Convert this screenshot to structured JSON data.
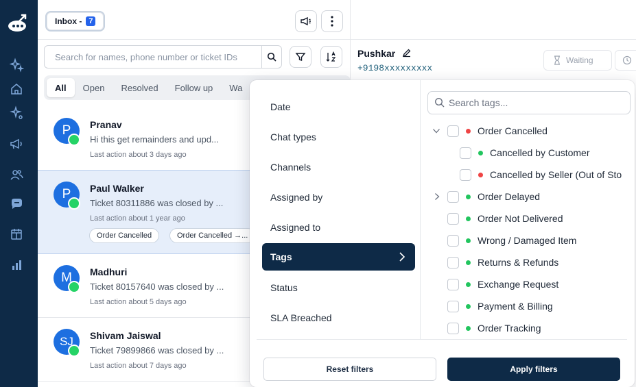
{
  "inbox": {
    "label": "Inbox -",
    "count": "7"
  },
  "search": {
    "placeholder": "Search for names, phone number or ticket IDs"
  },
  "tabs": [
    "All",
    "Open",
    "Resolved",
    "Follow up",
    "Wa"
  ],
  "conversations": [
    {
      "initial": "P",
      "name": "Pranav",
      "message": "Hi this get remainders and upd...",
      "time": "Last action about 3 days ago",
      "tags": []
    },
    {
      "initial": "P",
      "name": "Paul Walker",
      "message": "Ticket 80311886 was closed by ...",
      "time": "Last action about 1 year ago",
      "tags": [
        "Order Cancelled",
        "Order Cancelled →..."
      ]
    },
    {
      "initial": "M",
      "name": "Madhuri",
      "message": "Ticket 80157640 was closed by ...",
      "time": "Last action about 5 days ago",
      "tags": []
    },
    {
      "initial": "SJ",
      "name": "Shivam Jaiswal",
      "message": "Ticket 79899866 was closed by ...",
      "time": "Last action about 7 days ago",
      "tags": []
    }
  ],
  "contact": {
    "name": "Pushkar",
    "phone": "+9198xxxxxxxxx",
    "status": "Waiting"
  },
  "filter": {
    "categories": [
      "Date",
      "Chat types",
      "Channels",
      "Assigned by",
      "Assigned to",
      "Tags",
      "Status",
      "SLA Breached"
    ],
    "active_category": "Tags",
    "tag_search_placeholder": "Search tags...",
    "tags": [
      {
        "label": "Order Cancelled",
        "color": "#ef4444",
        "expand": "open",
        "indent": 0
      },
      {
        "label": "Cancelled by Customer",
        "color": "#22c55e",
        "expand": "none",
        "indent": 1
      },
      {
        "label": "Cancelled by Seller (Out of Sto",
        "color": "#ef4444",
        "expand": "none",
        "indent": 1
      },
      {
        "label": "Order Delayed",
        "color": "#22c55e",
        "expand": "closed",
        "indent": 0
      },
      {
        "label": "Order Not Delivered",
        "color": "#22c55e",
        "expand": "none",
        "indent": 0
      },
      {
        "label": "Wrong / Damaged Item",
        "color": "#22c55e",
        "expand": "none",
        "indent": 0
      },
      {
        "label": "Returns & Refunds",
        "color": "#22c55e",
        "expand": "none",
        "indent": 0
      },
      {
        "label": "Exchange Request",
        "color": "#22c55e",
        "expand": "none",
        "indent": 0
      },
      {
        "label": "Payment & Billing",
        "color": "#22c55e",
        "expand": "none",
        "indent": 0
      },
      {
        "label": "Order Tracking",
        "color": "#22c55e",
        "expand": "none",
        "indent": 0
      }
    ],
    "reset_label": "Reset filters",
    "apply_label": "Apply filters"
  },
  "colors": {
    "navy": "#0e2a47",
    "accent": "#2563eb",
    "selected_row": "#e6eefa",
    "whatsapp": "#25d366"
  }
}
